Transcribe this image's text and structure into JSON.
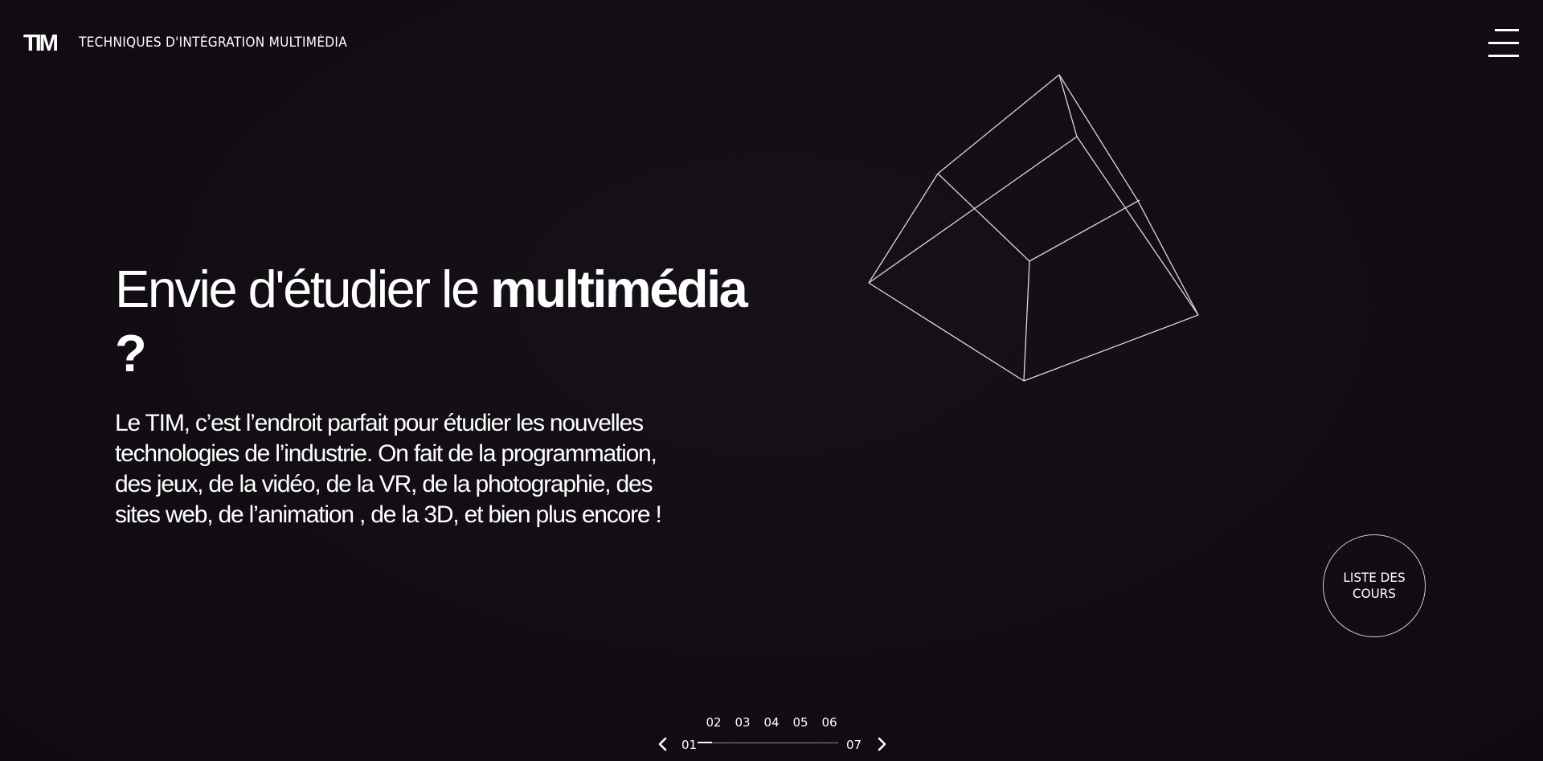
{
  "header": {
    "logo_text": "TIM",
    "site_title": "TECHNIQUES D'INTÉGRATION MULTIMÉDIA",
    "menu_icon": "hamburger-menu-icon"
  },
  "hero": {
    "title_light": "Envie d'étudier le ",
    "title_bold": "multimédia",
    "title_end": " ?",
    "description": "Le TIM, c’est l’endroit parfait pour étudier les nouvelles technologies de l’industrie. On fait de la programmation, des jeux, de la vidéo, de la VR, de la photographie, des sites web, de l’animation , de la 3D, et bien plus encore !"
  },
  "courses_button": {
    "label": "LISTE DES COURS"
  },
  "slider": {
    "numbers": [
      "02",
      "03",
      "04",
      "05",
      "06"
    ],
    "current": "01",
    "last": "07",
    "progress": 0.1,
    "prev_icon": "chevron-left-icon",
    "next_icon": "chevron-right-icon"
  },
  "colors": {
    "background": "#110d13",
    "text": "#ffffff",
    "wireframe": "#d9d9d9"
  }
}
